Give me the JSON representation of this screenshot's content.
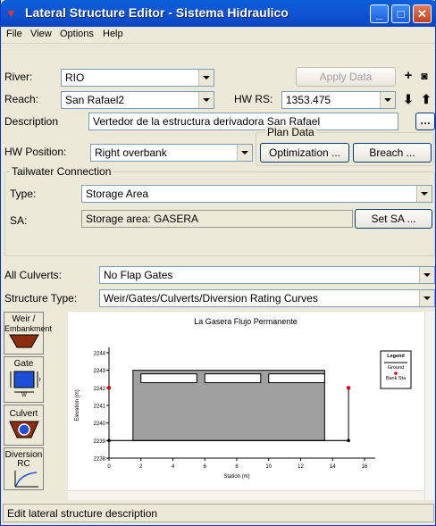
{
  "window": {
    "title": "Lateral Structure Editor - Sistema Hidraulico",
    "app_icon": "weir-logo-icon",
    "minimize": "_",
    "maximize": "□",
    "close": "✕"
  },
  "menu": {
    "items": [
      "File",
      "View",
      "Options",
      "Help"
    ]
  },
  "river": {
    "label": "River:",
    "value": "RIO"
  },
  "reach": {
    "label": "Reach:",
    "value": "San Rafael2"
  },
  "hw_rs": {
    "label": "HW RS:",
    "value": "1353.475"
  },
  "apply_data": "Apply Data",
  "description": {
    "label": "Description",
    "value": "Vertedor de la estructura derivadora San Rafael"
  },
  "hw_position": {
    "label": "HW Position:",
    "value": "Right overbank"
  },
  "plan_data": {
    "title": "Plan Data",
    "optimization": "Optimization ...",
    "breach": "Breach ..."
  },
  "tailwater": {
    "title": "Tailwater Connection",
    "type_label": "Type:",
    "type_value": "Storage Area",
    "sa_label": "SA:",
    "sa_value": "Storage area: GASERA",
    "set_sa": "Set SA ..."
  },
  "all_culverts": {
    "label": "All Culverts:",
    "value": "No Flap Gates"
  },
  "structure_type": {
    "label": "Structure Type:",
    "value": "Weir/Gates/Culverts/Diversion Rating Curves"
  },
  "side_buttons": {
    "weir": "Weir / Embankment",
    "weir_l1": "Weir /",
    "weir_l2": "Embankment",
    "gate": "Gate",
    "culvert": "Culvert",
    "diversion_l1": "Diversion",
    "diversion_l2": "RC"
  },
  "status": "Edit lateral structure description",
  "chart_data": {
    "type": "line",
    "title": "La Gasera Flujo Permanente",
    "xlabel": "Station (m)",
    "ylabel": "Elevation (m)",
    "xlim": [
      0,
      16
    ],
    "ylim": [
      2238,
      2244
    ],
    "x_ticks": [
      "0",
      "2",
      "4",
      "6",
      "8",
      "10",
      "12",
      "14",
      "16"
    ],
    "y_ticks": [
      "2238",
      "2239",
      "2240",
      "2241",
      "2242",
      "2243",
      "2244"
    ],
    "legend": {
      "title": "Legend",
      "entries": [
        "Ground",
        "Bank Sta"
      ]
    },
    "weir": {
      "x": [
        1.5,
        13.5
      ],
      "crest": 2243,
      "base": 2239
    },
    "gates": [
      {
        "x": [
          2,
          5.5
        ],
        "bottom": 2242.5,
        "top": 2243
      },
      {
        "x": [
          6,
          9.5
        ],
        "bottom": 2242.5,
        "top": 2243
      },
      {
        "x": [
          10,
          13.5
        ],
        "bottom": 2242.5,
        "top": 2243
      }
    ],
    "ground": {
      "x": [
        0,
        15
      ],
      "y": [
        2239,
        2239
      ]
    },
    "bank_stations": [
      {
        "x": 0,
        "y": 2242
      },
      {
        "x": 15,
        "y": 2242
      }
    ]
  }
}
